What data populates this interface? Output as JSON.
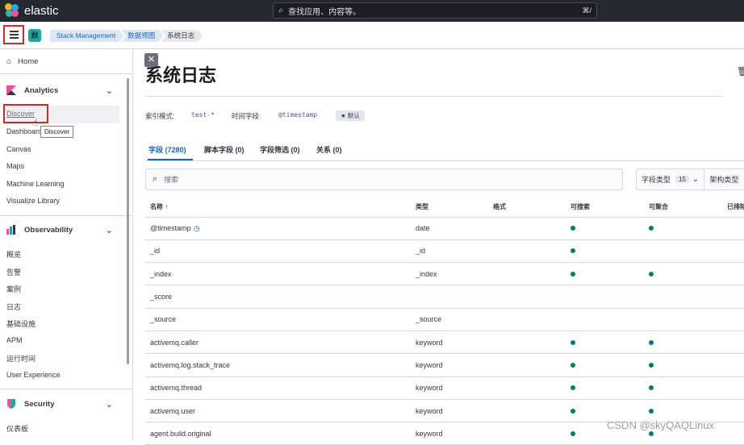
{
  "brand": {
    "name": "elastic"
  },
  "search": {
    "placeholder": "查找应用、内容等。",
    "shortcut": "⌘/"
  },
  "space_badge": "默",
  "breadcrumbs": [
    "Stack Management",
    "数据视图",
    "系统日志"
  ],
  "sidebar": {
    "home": "Home",
    "analytics": {
      "title": "Analytics",
      "items": [
        "Discover",
        "Dashboard",
        "Canvas",
        "Maps",
        "Machine Learning",
        "Visualize Library"
      ]
    },
    "observability": {
      "title": "Observability",
      "items": [
        "概览",
        "告警",
        "案例",
        "日志",
        "基础设施",
        "APM",
        "运行时间",
        "User Experience"
      ]
    },
    "security": {
      "title": "Security",
      "items": [
        "仪表板"
      ]
    }
  },
  "tooltip": "Discover",
  "page": {
    "title": "系统日志",
    "index_pattern_label": "索引模式:",
    "index_pattern_value": "test-*",
    "time_field_label": "时间字段:",
    "time_field_value": "@timestamp",
    "default_badge": "★ 默认"
  },
  "tabs": [
    {
      "label": "字段 (7280)",
      "active": true
    },
    {
      "label": "脚本字段 (0)",
      "active": false
    },
    {
      "label": "字段筛选 (0)",
      "active": false
    },
    {
      "label": "关系 (0)",
      "active": false
    }
  ],
  "field_search": {
    "placeholder": "搜索"
  },
  "filters": {
    "type_label": "字段类型",
    "type_count": "15",
    "schema_label": "架构类型"
  },
  "table": {
    "columns": [
      "名称 ↑",
      "类型",
      "格式",
      "可搜索",
      "可聚合",
      "已排除"
    ],
    "rows": [
      {
        "name": "@timestamp",
        "type": "date",
        "format": "",
        "searchable": true,
        "aggregatable": true,
        "time": true
      },
      {
        "name": "_id",
        "type": "_id",
        "format": "",
        "searchable": true,
        "aggregatable": false
      },
      {
        "name": "_index",
        "type": "_index",
        "format": "",
        "searchable": true,
        "aggregatable": true
      },
      {
        "name": "_score",
        "type": "",
        "format": "",
        "searchable": false,
        "aggregatable": false
      },
      {
        "name": "_source",
        "type": "_source",
        "format": "",
        "searchable": false,
        "aggregatable": false
      },
      {
        "name": "activemq.caller",
        "type": "keyword",
        "format": "",
        "searchable": true,
        "aggregatable": true
      },
      {
        "name": "activemq.log.stack_trace",
        "type": "keyword",
        "format": "",
        "searchable": true,
        "aggregatable": true
      },
      {
        "name": "activemq.thread",
        "type": "keyword",
        "format": "",
        "searchable": true,
        "aggregatable": true
      },
      {
        "name": "activemq.user",
        "type": "keyword",
        "format": "",
        "searchable": true,
        "aggregatable": true
      },
      {
        "name": "agent.build.original",
        "type": "keyword",
        "format": "",
        "searchable": true,
        "aggregatable": true
      }
    ]
  },
  "watermark": "CSDN @skyQAQLinux"
}
